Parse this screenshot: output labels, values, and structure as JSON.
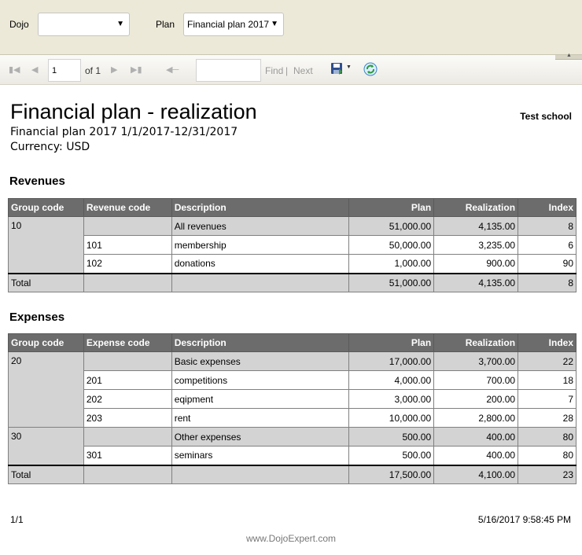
{
  "params": {
    "dojo_label": "Dojo",
    "dojo_value": "",
    "plan_label": "Plan",
    "plan_value": "Financial plan 2017"
  },
  "toolbar": {
    "page_value": "1",
    "of_text": "of 1",
    "search_value": "",
    "find_label": "Find",
    "separator": "|",
    "next_label": "Next"
  },
  "report": {
    "title": "Financial plan - realization",
    "school": "Test school",
    "subtitle": "Financial plan 2017 1/1/2017-12/31/2017",
    "currency": "Currency: USD"
  },
  "revenues": {
    "section_title": "Revenues",
    "columns": [
      "Group code",
      "Revenue code",
      "Description",
      "Plan",
      "Realization",
      "Index"
    ],
    "groups": [
      {
        "group_code": "10",
        "rows": [
          {
            "code": "",
            "description": "All revenues",
            "plan": "51,000.00",
            "realization": "4,135.00",
            "index": "8"
          },
          {
            "code": "101",
            "description": "membership",
            "plan": "50,000.00",
            "realization": "3,235.00",
            "index": "6"
          },
          {
            "code": "102",
            "description": "donations",
            "plan": "1,000.00",
            "realization": "900.00",
            "index": "90"
          }
        ]
      }
    ],
    "total": {
      "label": "Total",
      "plan": "51,000.00",
      "realization": "4,135.00",
      "index": "8"
    }
  },
  "expenses": {
    "section_title": "Expenses",
    "columns": [
      "Group code",
      "Expense code",
      "Description",
      "Plan",
      "Realization",
      "Index"
    ],
    "groups": [
      {
        "group_code": "20",
        "rows": [
          {
            "code": "",
            "description": "Basic expenses",
            "plan": "17,000.00",
            "realization": "3,700.00",
            "index": "22"
          },
          {
            "code": "201",
            "description": "competitions",
            "plan": "4,000.00",
            "realization": "700.00",
            "index": "18"
          },
          {
            "code": "202",
            "description": "eqipment",
            "plan": "3,000.00",
            "realization": "200.00",
            "index": "7"
          },
          {
            "code": "203",
            "description": "rent",
            "plan": "10,000.00",
            "realization": "2,800.00",
            "index": "28"
          }
        ]
      },
      {
        "group_code": "30",
        "rows": [
          {
            "code": "",
            "description": "Other expenses",
            "plan": "500.00",
            "realization": "400.00",
            "index": "80"
          },
          {
            "code": "301",
            "description": "seminars",
            "plan": "500.00",
            "realization": "400.00",
            "index": "80"
          }
        ]
      }
    ],
    "total": {
      "label": "Total",
      "plan": "17,500.00",
      "realization": "4,100.00",
      "index": "23"
    }
  },
  "footer": {
    "page": "1/1",
    "datetime": "5/16/2017 9:58:45 PM",
    "brand": "www.DojoExpert.com"
  },
  "icons": {
    "first": "first-page-icon",
    "prev": "previous-page-icon",
    "next": "next-page-icon",
    "last": "last-page-icon",
    "back": "back-icon",
    "save": "save-icon",
    "refresh": "refresh-icon"
  }
}
